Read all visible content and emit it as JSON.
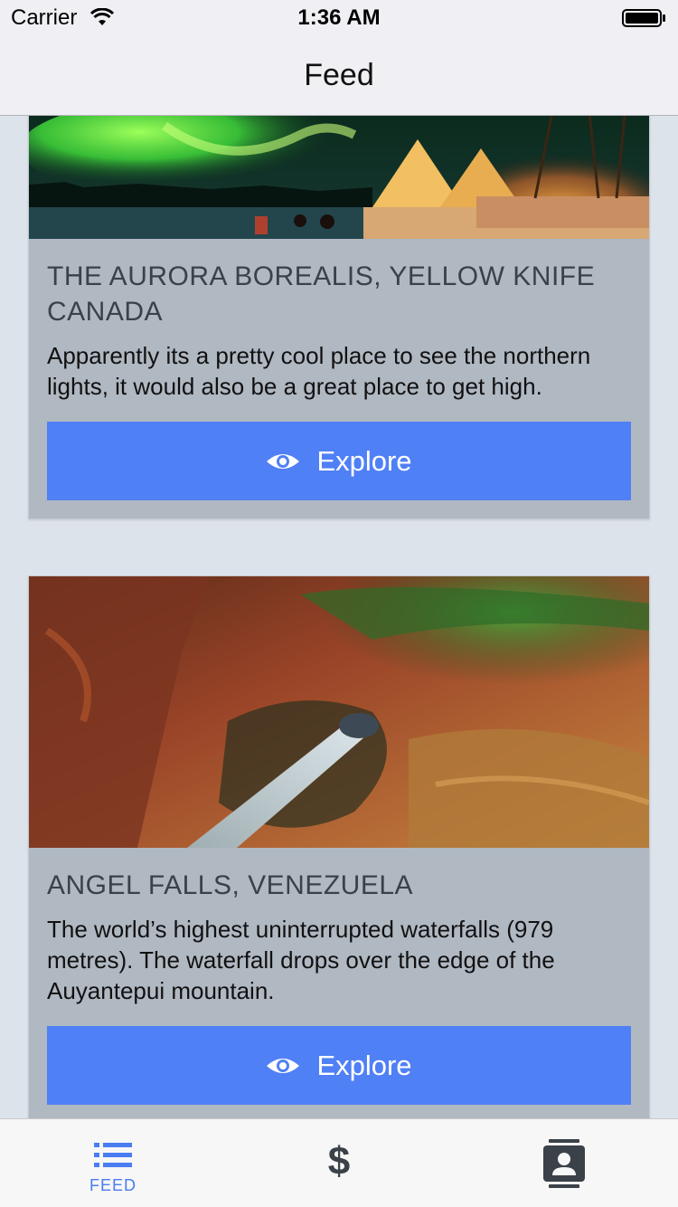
{
  "status_bar": {
    "carrier": "Carrier",
    "time": "1:36 AM"
  },
  "nav": {
    "title": "Feed"
  },
  "cards": [
    {
      "title": "THE AURORA BOREALIS, YELLOW KNIFE CANADA",
      "description": "Apparently its a pretty cool place to see the northern lights, it would also be a great place to get high.",
      "button_label": "Explore"
    },
    {
      "title": "ANGEL FALLS, VENEZUELA",
      "description": "The world’s highest uninterrupted waterfalls (979 metres). The waterfall drops over the edge of the Auyantepui mountain.",
      "button_label": "Explore"
    }
  ],
  "tab_bar": {
    "feed_label": "FEED",
    "dollar_symbol": "$",
    "active_color": "#4a7cf2",
    "inactive_color": "#3b4148"
  },
  "colors": {
    "button": "#5080f5",
    "card": "#b0b8c2",
    "background": "#dde3ea"
  }
}
